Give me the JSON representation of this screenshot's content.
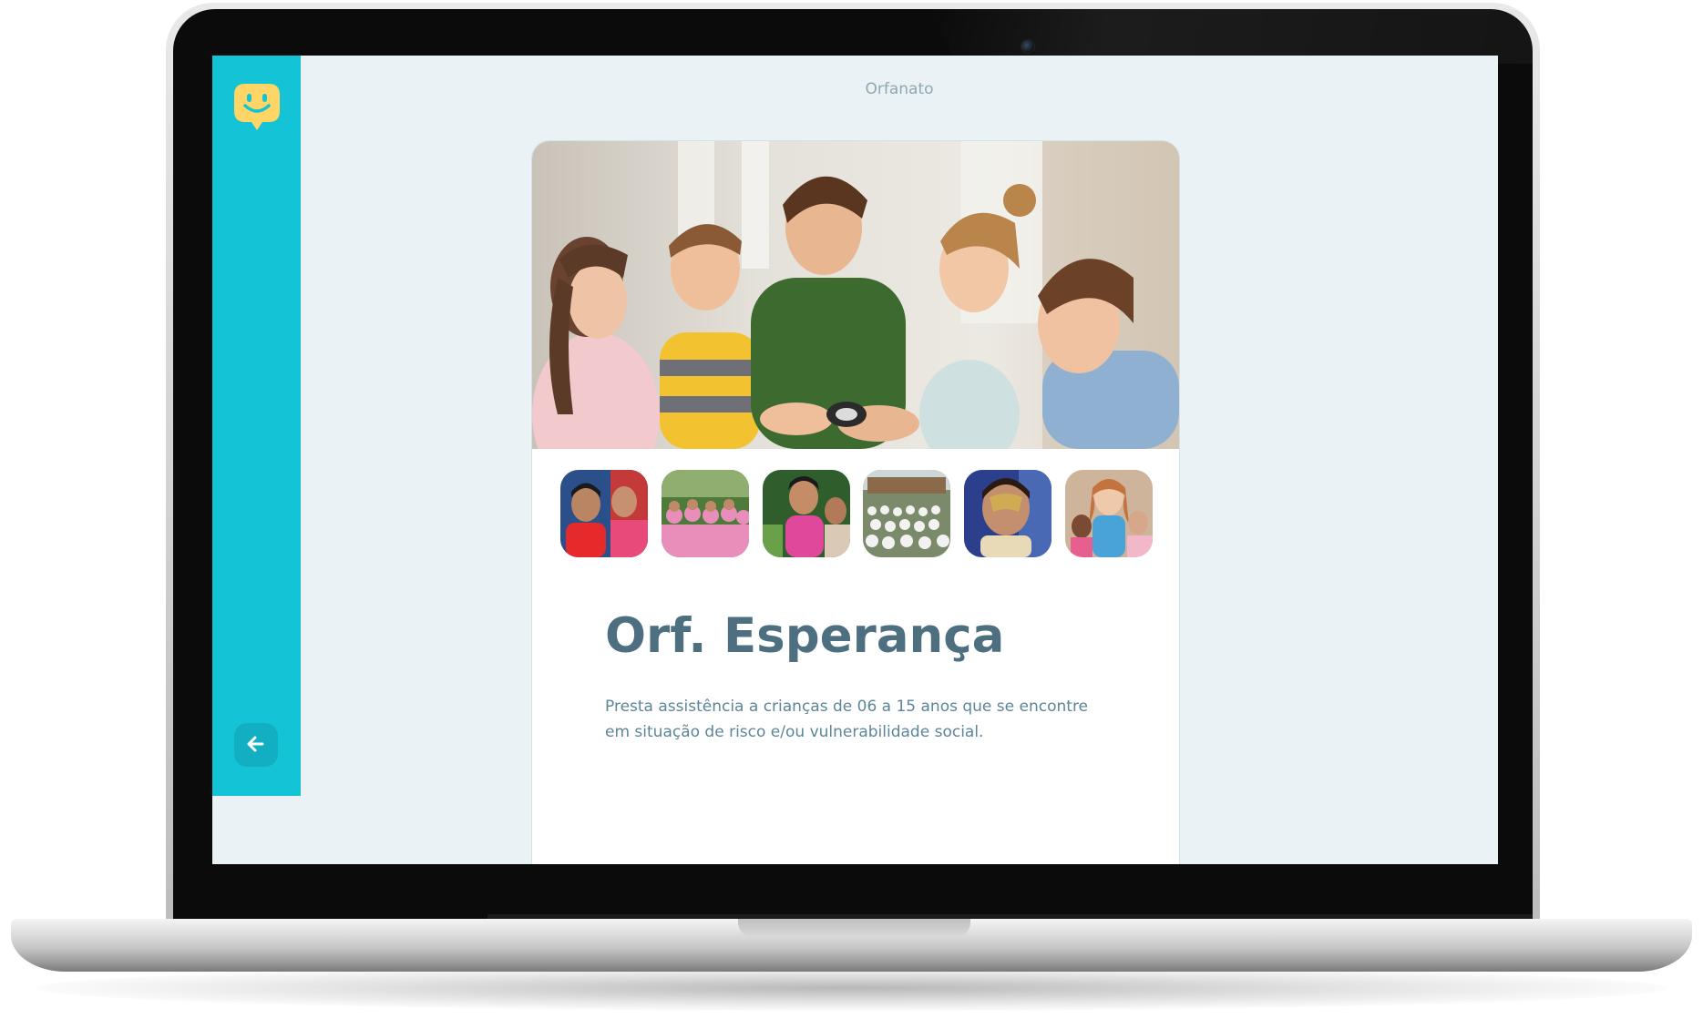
{
  "header": {
    "title": "Orfanato"
  },
  "sidebar": {
    "logo_icon": "smiley-chat-icon",
    "back_icon": "arrow-left-icon"
  },
  "orphanage": {
    "name": "Orf. Esperança",
    "about": "Presta assistência a crianças de 06 a 15 anos que se encontre em situação de risco e/ou vulnerabilidade social.",
    "images": [
      "children-studying-photo",
      "two-children-photo",
      "group-in-pink-photo",
      "girl-in-garden-photo",
      "crowd-at-school-photo",
      "child-face-paint-photo",
      "volunteer-with-kids-photo"
    ]
  },
  "colors": {
    "sidebar": "#15C3D6",
    "background": "#EBF2F5",
    "title": "#4D6F80",
    "text": "#5C8599",
    "logo": "#FFD666"
  }
}
